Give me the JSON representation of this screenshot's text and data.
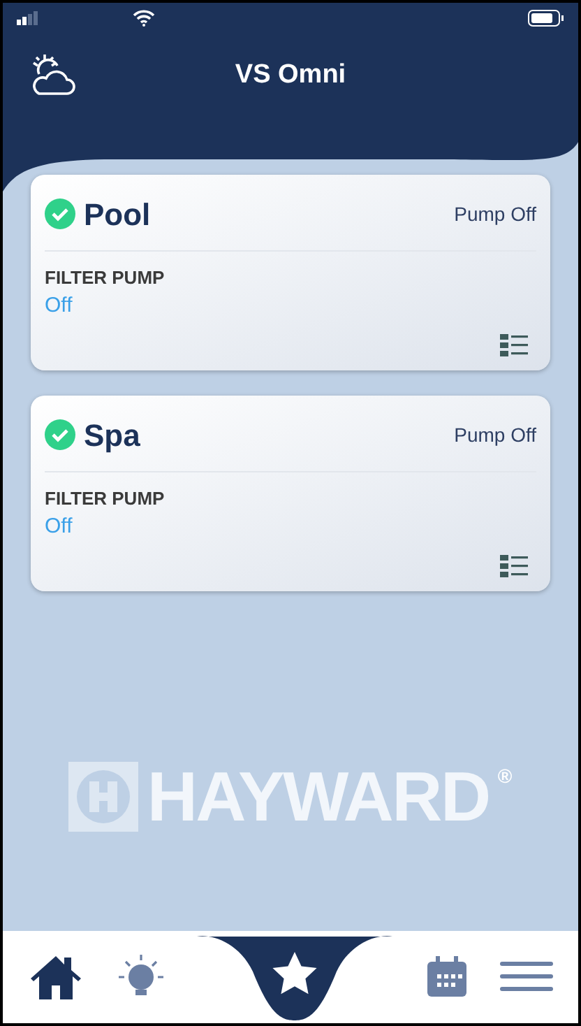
{
  "header": {
    "title": "VS Omni"
  },
  "cards": [
    {
      "name": "Pool",
      "ok": true,
      "status": "Pump Off",
      "equipment_label": "FILTER PUMP",
      "equipment_value": "Off"
    },
    {
      "name": "Spa",
      "ok": true,
      "status": "Pump Off",
      "equipment_label": "FILTER PUMP",
      "equipment_value": "Off"
    }
  ],
  "brand": {
    "text": "HAYWARD",
    "mark": "®"
  },
  "nav": [
    {
      "kind": "home",
      "selected": false
    },
    {
      "kind": "lights",
      "selected": false
    },
    {
      "kind": "favorites",
      "selected": true
    },
    {
      "kind": "schedule",
      "selected": false
    },
    {
      "kind": "menu",
      "selected": false
    }
  ]
}
